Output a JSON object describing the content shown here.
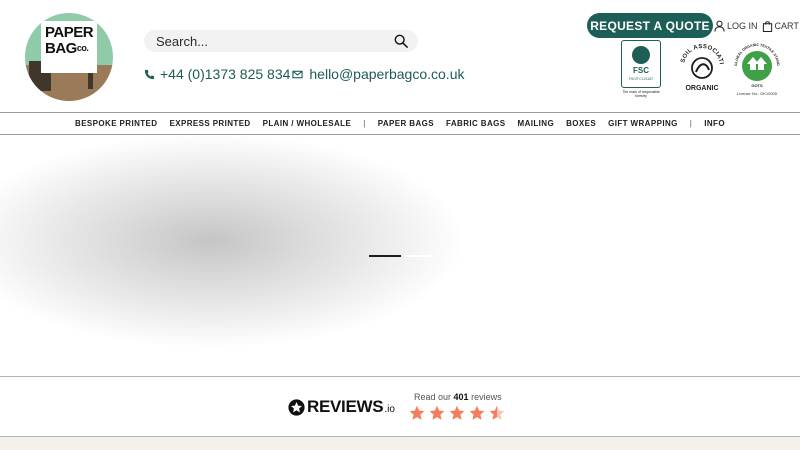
{
  "logo": {
    "line1": "PAPER",
    "line2": "BAG",
    "suffix": "co."
  },
  "search": {
    "placeholder": "Search..."
  },
  "contact": {
    "phone": "+44 (0)1373 825 834",
    "email": "hello@paperbagco.co.uk"
  },
  "header": {
    "quote_label": "REQUEST A QUOTE",
    "login_label": "LOG IN",
    "cart_label": "CART"
  },
  "certs": {
    "fsc_label": "FSC",
    "fsc_code": "FSC® C121187",
    "fsc_mark": "The mark of responsible forestry",
    "soil_text": "SOIL ASSOCIATION",
    "soil_organic": "ORGANIC",
    "gots_text": "GLOBAL ORGANIC TEXTILE STANDARD",
    "gots_short": "GOTS",
    "gots_license": "License No.: DK10005"
  },
  "nav": {
    "items": [
      "BESPOKE PRINTED",
      "EXPRESS PRINTED",
      "PLAIN / WHOLESALE",
      "PAPER BAGS",
      "FABRIC BAGS",
      "MAILING",
      "BOXES",
      "GIFT WRAPPING",
      "INFO"
    ],
    "separator": "|"
  },
  "reviews": {
    "brand": "REVIEWS",
    "tld": ".io",
    "prefix": "Read our",
    "count": "401",
    "suffix": "reviews",
    "rating": 4.5,
    "star_color": "#f47e5b"
  },
  "colors": {
    "brand_green": "#1d5f56",
    "logo_green": "#8fcba8"
  }
}
